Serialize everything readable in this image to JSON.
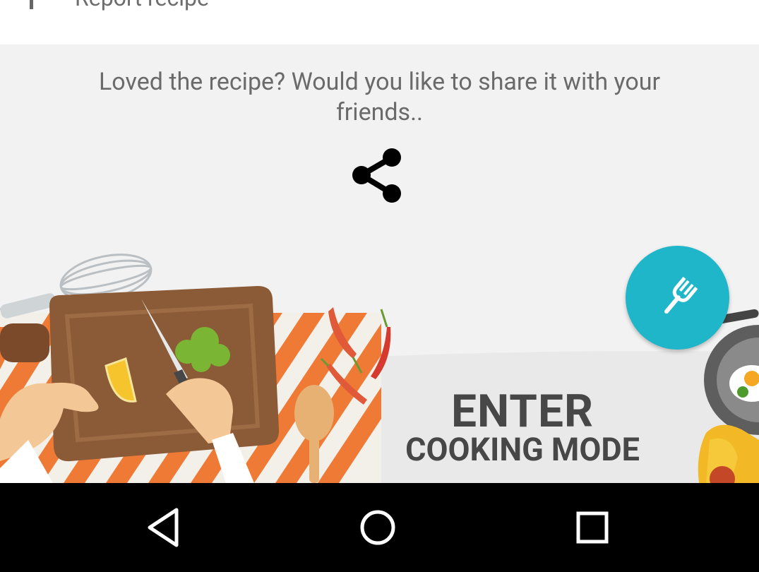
{
  "menu": {
    "report_label": "Report recipe",
    "report_icon": "report-flag-icon"
  },
  "share": {
    "prompt": "Loved the recipe? Would you like to share it with your friends..",
    "icon": "share-icon"
  },
  "banner": {
    "title_line1": "ENTER",
    "title_line2": "COOKING MODE"
  },
  "fab": {
    "icon": "fork-icon",
    "color": "#1eb6c8"
  },
  "navbar": {
    "back_icon": "back-icon",
    "home_icon": "home-icon",
    "recents_icon": "recents-icon"
  }
}
